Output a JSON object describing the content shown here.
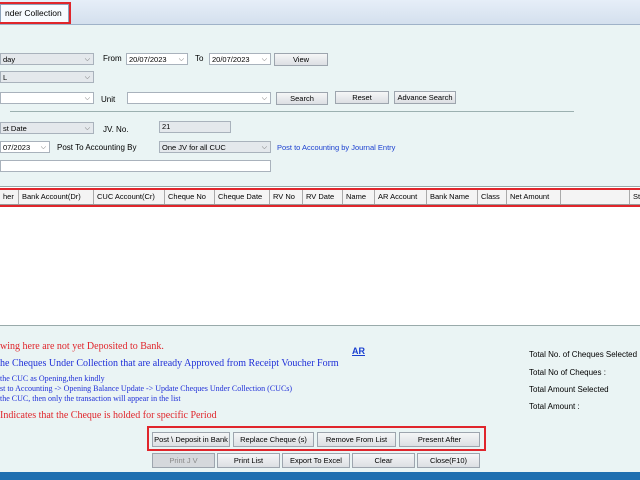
{
  "tab": {
    "title": "nder Collection"
  },
  "filters": {
    "period_value": "day",
    "from_label": "From",
    "from_date": "20/07/2023",
    "to_label": "To",
    "to_date": "20/07/2023",
    "view_label": "View",
    "second_value": "L",
    "unit_label": "Unit",
    "search_label": "Search",
    "reset_label": "Reset",
    "advance_search_label": "Advance Search"
  },
  "posting": {
    "date_type_value": "st Date",
    "jv_no_label": "JV. No.",
    "jv_no_value": "21",
    "post_date": "07/2023",
    "post_by_label": "Post To Accounting By",
    "post_by_value": "One JV for all CUC",
    "journal_link": "Post to Accounting by Journal Entry"
  },
  "table": {
    "columns": [
      "her",
      "Bank Account(Dr)",
      "CUC Account(Cr)",
      "Cheque No",
      "Cheque Date",
      "RV No",
      "RV Date",
      "Name",
      "AR Account",
      "Bank Name",
      "Class",
      "Net Amount",
      "",
      "St"
    ]
  },
  "notes": {
    "line1": "wing here are not yet Deposited to Bank.",
    "line2": "he Cheques Under Collection that are already Approved from Receipt Voucher Form",
    "line3": "the CUC as Opening,then kindly",
    "line4": "st to Accounting -> Opening Balance Update -> Update Cheques Under Collection (CUCs)",
    "line5": "the CUC, then only the transaction will appear in the list",
    "line6": "Indicates that the Cheque is holded for specific Period",
    "ar_link": "AR"
  },
  "totals": {
    "selected_count_label": "Total No. of Cheques  Selected",
    "count_label": "Total No of Cheques :",
    "selected_amount_label": "Total Amount Selected",
    "amount_label": "Total Amount :"
  },
  "actions": {
    "post_deposit": "Post \\ Deposit in Bank",
    "replace_cheque": "Replace Cheque (s)",
    "remove_from_list": "Remove From List",
    "present_after": "Present After",
    "print_jv": "Print J V",
    "print_list": "Print List",
    "export_excel": "Export To Excel",
    "clear": "Clear",
    "close": "Close(F10)"
  },
  "colors": {
    "red_highlight": "#e0252b",
    "link_blue": "#1a3fd0",
    "note_red": "#e0252b",
    "note_blue": "#1f2fd8"
  }
}
